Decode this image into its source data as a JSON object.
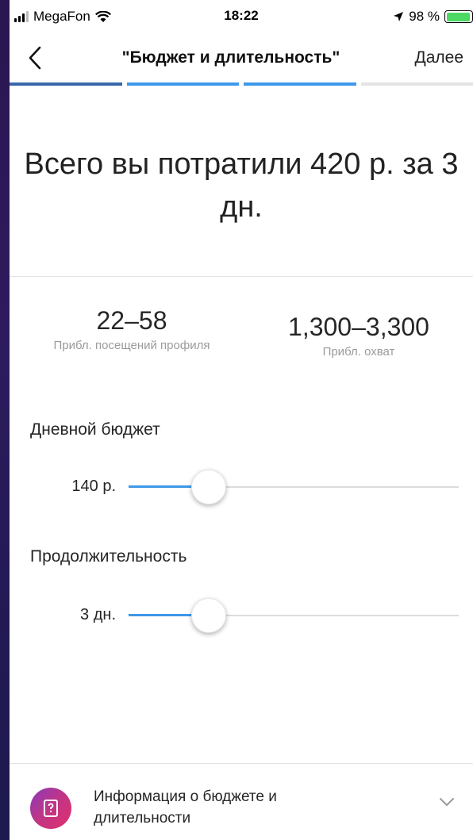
{
  "status_bar": {
    "carrier": "MegaFon",
    "time": "18:22",
    "battery_text": "98 %"
  },
  "nav": {
    "title": "\"Бюджет и длительность\"",
    "next_label": "Далее",
    "progress_steps_done": 3,
    "progress_steps_total": 4
  },
  "headline": "Всего вы потратили 420 р. за 3 дн.",
  "stats": [
    {
      "value": "22–58",
      "label": "Прибл. посещений профиля"
    },
    {
      "value": "1,300–3,300",
      "label": "Прибл. охват"
    }
  ],
  "daily_budget": {
    "title": "Дневной бюджет",
    "value_label": "140 р."
  },
  "duration": {
    "title": "Продолжительность",
    "value_label": "3 дн."
  },
  "footer": {
    "text": "Информация о бюджете и длительности"
  },
  "colors": {
    "accent": "#3e98e8",
    "progress_first": "#3867a8",
    "battery": "#4cd964"
  }
}
